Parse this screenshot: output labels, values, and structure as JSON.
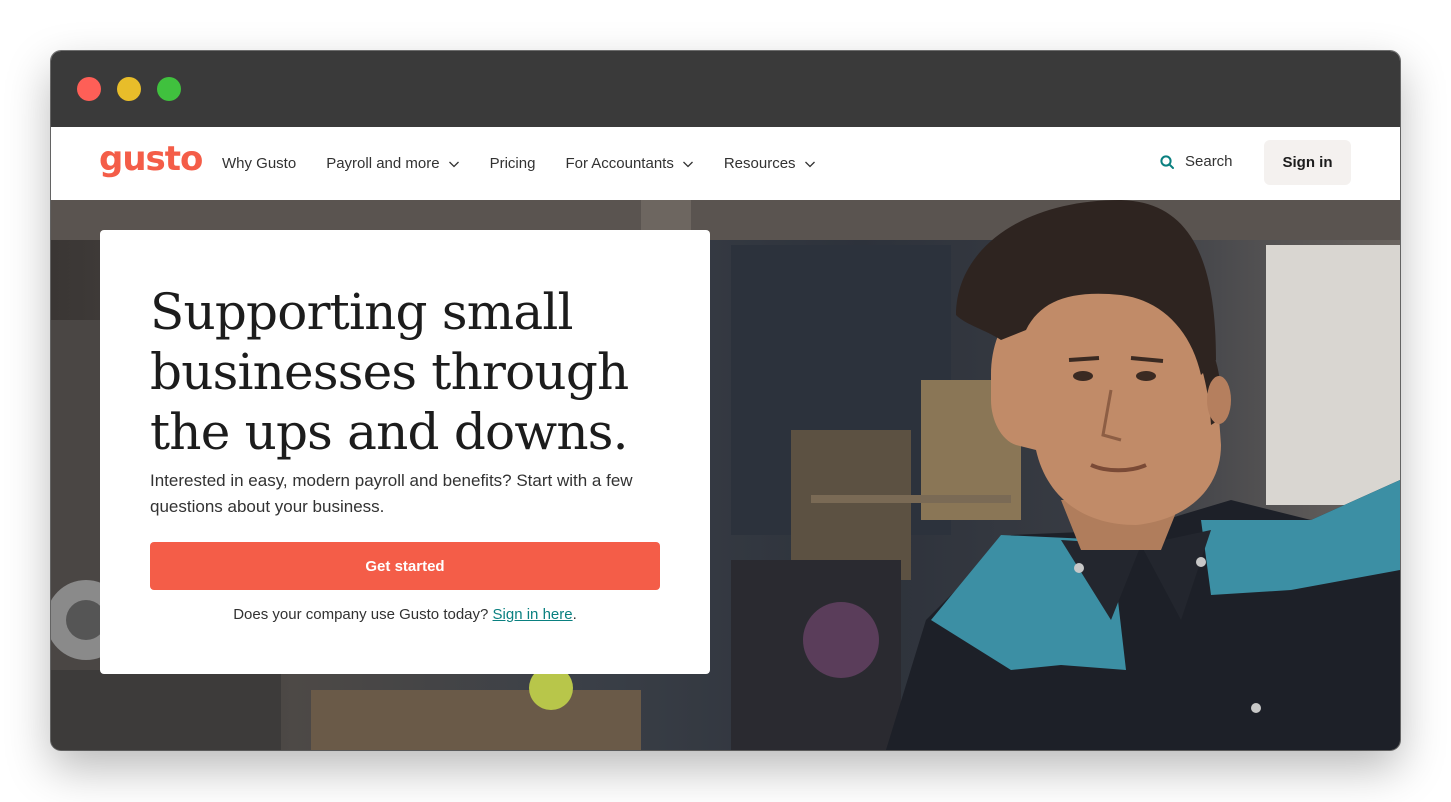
{
  "brand": {
    "logo_text": "gusto",
    "accent_color": "#f45d48",
    "link_color": "#0a8080"
  },
  "window": {
    "controls": [
      "close",
      "minimize",
      "zoom"
    ]
  },
  "nav": {
    "items": [
      {
        "label": "Why Gusto",
        "has_dropdown": false
      },
      {
        "label": "Payroll and more",
        "has_dropdown": true
      },
      {
        "label": "Pricing",
        "has_dropdown": false
      },
      {
        "label": "For Accountants",
        "has_dropdown": true
      },
      {
        "label": "Resources",
        "has_dropdown": true
      }
    ],
    "search_label": "Search",
    "search_icon": "search-icon",
    "signin_label": "Sign in"
  },
  "hero": {
    "headline": "Supporting small businesses through the ups and downs.",
    "subtext": "Interested in easy, modern payroll and benefits? Start with a few questions about your business.",
    "cta_label": "Get started",
    "existing_prefix": "Does your company use Gusto today? ",
    "existing_link": "Sign in here",
    "existing_suffix": "."
  }
}
